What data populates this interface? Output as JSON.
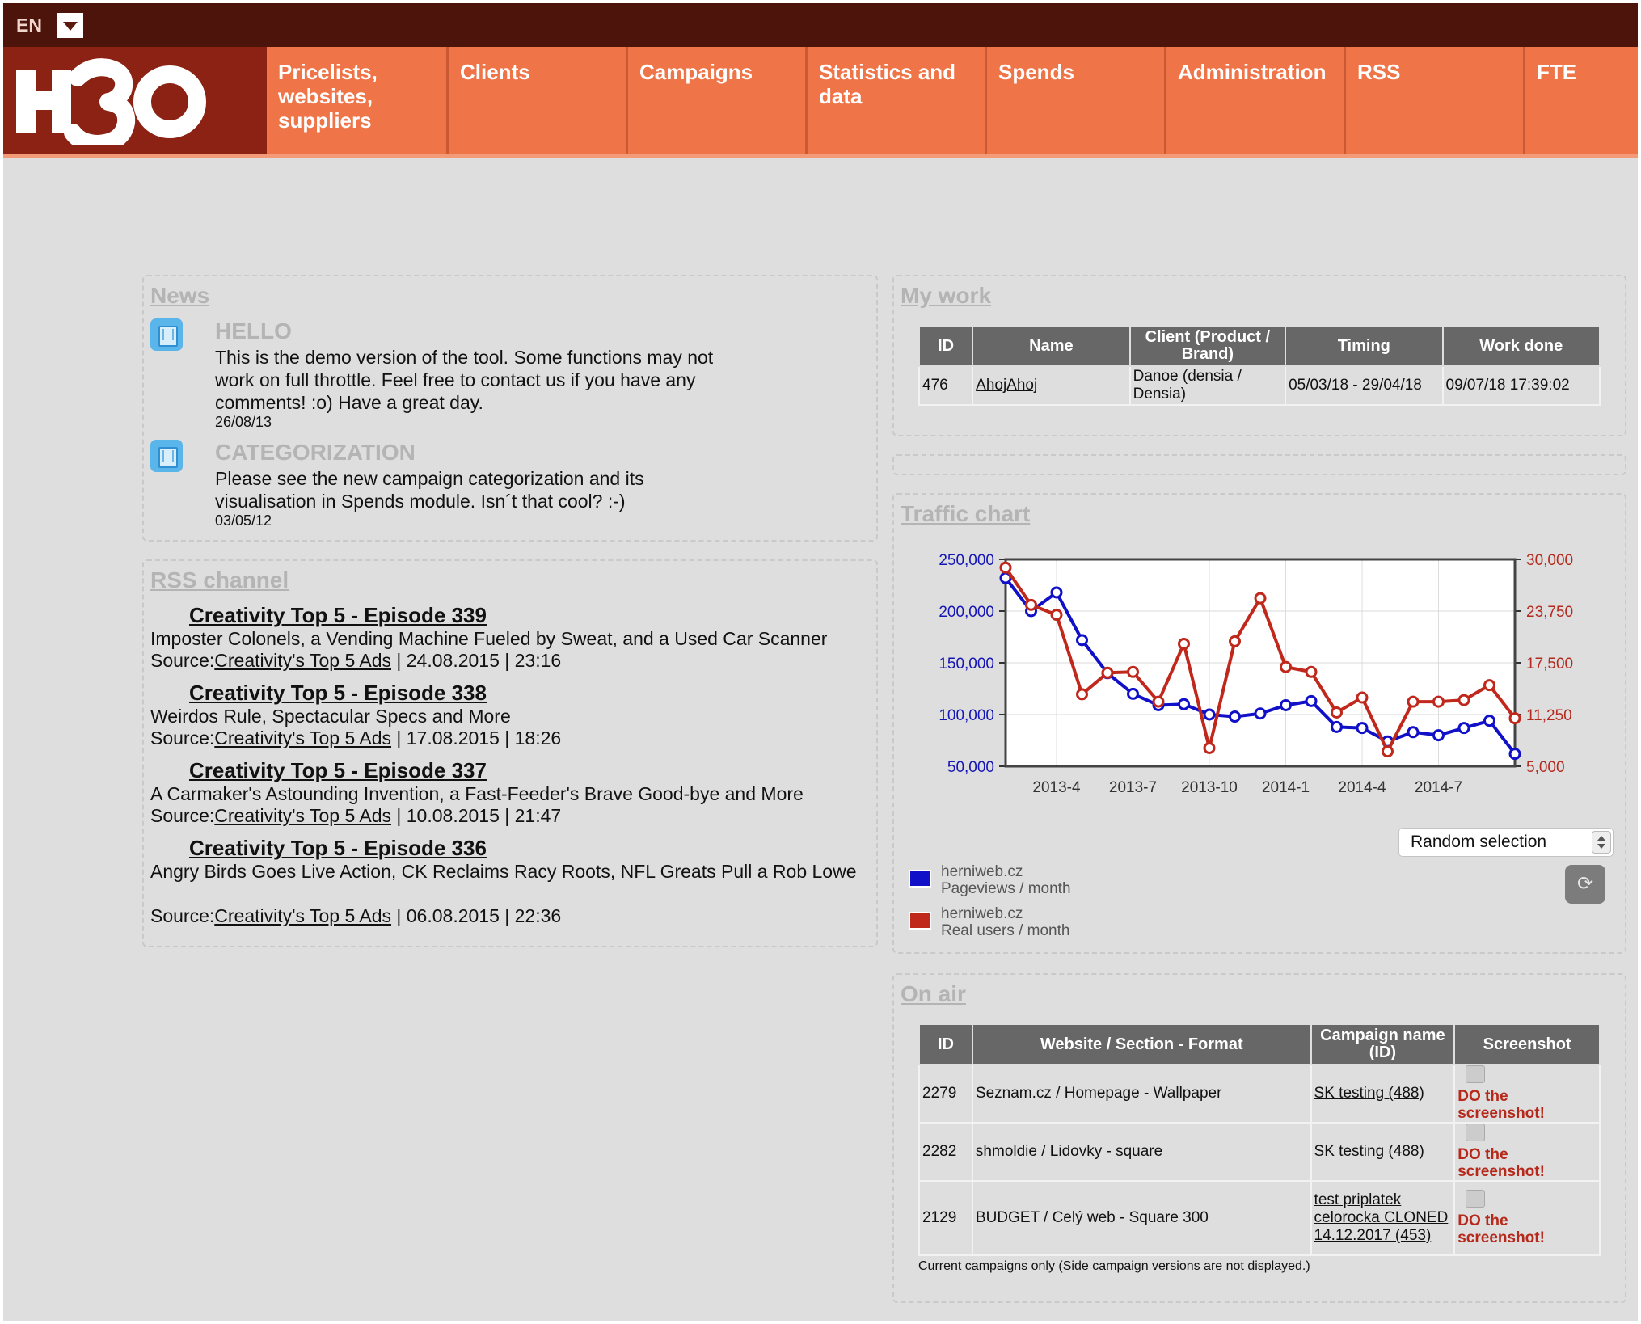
{
  "top_bar": {
    "language": "EN"
  },
  "nav": {
    "items": [
      {
        "label": "Pricelists, websites, suppliers"
      },
      {
        "label": "Clients"
      },
      {
        "label": "Campaigns"
      },
      {
        "label": "Statistics and data"
      },
      {
        "label": "Spends"
      },
      {
        "label": "Administration"
      },
      {
        "label": "RSS"
      },
      {
        "label": "FTE"
      }
    ]
  },
  "news": {
    "title": "News",
    "items": [
      {
        "heading": "HELLO",
        "text": "This is the demo version of the tool. Some functions may not work on full throttle. Feel free to contact us if you have any comments! :o) Have a great day.",
        "date": "26/08/13"
      },
      {
        "heading": "CATEGORIZATION",
        "text": "Please see the new campaign categorization and its visualisation in Spends module. Isn´t that cool? :-)",
        "date": "03/05/12"
      }
    ]
  },
  "rss": {
    "title": "RSS channel",
    "source_prefix": "Source:",
    "items": [
      {
        "title": "Creativity Top 5 - Episode 339",
        "desc": "Imposter Colonels, a Vending Machine Fueled by Sweat, and a Used Car Scanner",
        "source": "Creativity's Top 5 Ads",
        "date": " | 24.08.2015 | 23:16"
      },
      {
        "title": "Creativity Top 5 - Episode 338",
        "desc": "Weirdos Rule, Spectacular Specs and More",
        "source": "Creativity's Top 5 Ads",
        "date": " | 17.08.2015 | 18:26"
      },
      {
        "title": "Creativity Top 5 - Episode 337",
        "desc": "A Carmaker's Astounding Invention, a Fast-Feeder's Brave Good-bye and More",
        "source": "Creativity's Top 5 Ads",
        "date": " | 10.08.2015 | 21:47"
      },
      {
        "title": "Creativity Top 5 - Episode 336",
        "desc": "Angry Birds Goes Live Action, CK Reclaims Racy Roots, NFL Greats Pull a Rob Lowe",
        "source": "Creativity's Top 5 Ads",
        "date": " | 06.08.2015 | 22:36"
      }
    ]
  },
  "my_work": {
    "title": "My work",
    "columns": [
      "ID",
      "Name",
      "Client (Product / Brand)",
      "Timing",
      "Work done"
    ],
    "rows": [
      {
        "id": "476",
        "name": "AhojAhoj",
        "client": "Danoe (densia / Densia)",
        "timing": "05/03/18 - 29/04/18",
        "work_done": "09/07/18 17:39:02"
      }
    ]
  },
  "traffic": {
    "title": "Traffic chart",
    "select_value": "Random selection",
    "refresh_icon": "refresh-icon",
    "legend": [
      {
        "site": "herniweb.cz",
        "metric": "Pageviews / month",
        "color": "#1010c8"
      },
      {
        "site": "herniweb.cz",
        "metric": "Real users / month",
        "color": "#c0281c"
      }
    ]
  },
  "chart_data": {
    "type": "line",
    "x": [
      "2013-2",
      "2013-3",
      "2013-4",
      "2013-5",
      "2013-6",
      "2013-7",
      "2013-8",
      "2013-9",
      "2013-10",
      "2013-11",
      "2013-12",
      "2014-1",
      "2014-2",
      "2014-3",
      "2014-4",
      "2014-5",
      "2014-6",
      "2014-7",
      "2014-8",
      "2014-9",
      "2014-10"
    ],
    "xticks": [
      "2013-4",
      "2013-7",
      "2013-10",
      "2014-1",
      "2014-4",
      "2014-7"
    ],
    "series": [
      {
        "name": "herniweb.cz Pageviews / month",
        "axis": "left",
        "color": "#1010c8",
        "values": [
          232000,
          200000,
          218000,
          172000,
          140000,
          120000,
          109000,
          110000,
          100000,
          98000,
          101000,
          109000,
          113000,
          88000,
          87000,
          74000,
          83000,
          80000,
          87000,
          94000,
          62000
        ]
      },
      {
        "name": "herniweb.cz Real users / month",
        "axis": "right",
        "color": "#c0281c",
        "values": [
          29000,
          24500,
          23300,
          13700,
          16300,
          16400,
          12800,
          19800,
          7200,
          20100,
          25300,
          17000,
          16400,
          11500,
          13300,
          6800,
          12800,
          12800,
          13000,
          14800,
          10800
        ]
      }
    ],
    "y_left": {
      "ticks": [
        "250,000",
        "200,000",
        "150,000",
        "100,000",
        "50,000"
      ],
      "range": [
        50000,
        250000
      ]
    },
    "y_right": {
      "ticks": [
        "30,000",
        "23,750",
        "17,500",
        "11,250",
        "5,000"
      ],
      "range": [
        5000,
        30000
      ]
    },
    "grid": true,
    "legend_position": "bottom-left"
  },
  "on_air": {
    "title": "On air",
    "columns": [
      "ID",
      "Website / Section - Format",
      "Campaign name (ID)",
      "Screenshot"
    ],
    "rows": [
      {
        "id": "2279",
        "website": "Seznam.cz / Homepage - Wallpaper",
        "campaign": "SK testing (488)",
        "screenshot": "DO the screenshot!"
      },
      {
        "id": "2282",
        "website": "shmoldie / Lidovky - square",
        "campaign": "SK testing (488)",
        "screenshot": "DO the screenshot!"
      },
      {
        "id": "2129",
        "website": "BUDGET / Celý web - Square 300",
        "campaign": "test priplatek celorocka CLONED 14.12.2017 (453)",
        "screenshot": "DO the screenshot!"
      }
    ],
    "note": "Current campaigns only (Side campaign versions are not displayed.)"
  }
}
